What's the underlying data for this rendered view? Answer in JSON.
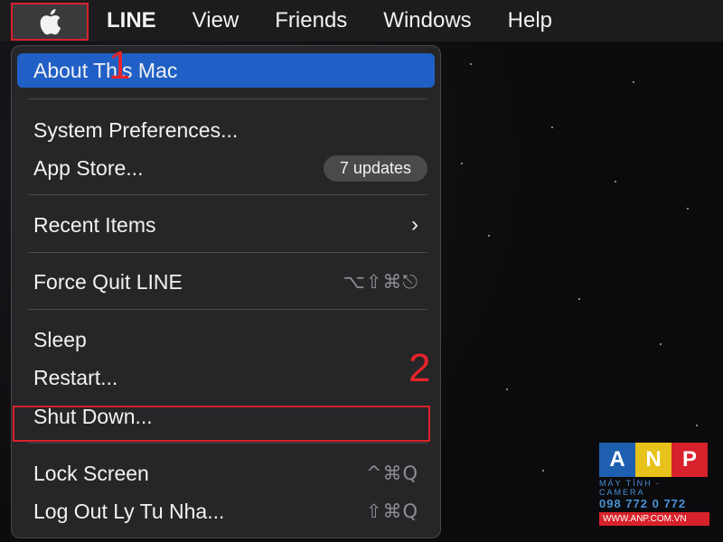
{
  "menubar": {
    "app_name": "LINE",
    "items": [
      "View",
      "Friends",
      "Windows",
      "Help"
    ]
  },
  "apple_menu": {
    "items": {
      "about": "About This Mac",
      "system_prefs": "System Preferences...",
      "app_store": "App Store...",
      "app_store_badge": "7 updates",
      "recent_items": "Recent Items",
      "force_quit": "Force Quit LINE",
      "force_quit_shortcut": "⌥⇧⌘⎋",
      "sleep": "Sleep",
      "restart": "Restart...",
      "shut_down": "Shut Down...",
      "lock_screen": "Lock Screen",
      "lock_screen_shortcut": "^⌘Q",
      "log_out": "Log Out Ly Tu Nha...",
      "log_out_shortcut": "⇧⌘Q"
    }
  },
  "annotations": {
    "step1": "1",
    "step2": "2"
  },
  "watermark": {
    "letters": [
      "A",
      "N",
      "P"
    ],
    "letter_colors": [
      "#1f5fb0",
      "#e7c21a",
      "#d8222b"
    ],
    "subtitle": "MÁY TÍNH - CAMERA",
    "phone": "098 772 0 772",
    "url": "WWW.ANP.COM.VN"
  },
  "colors": {
    "highlight": "#2060c6",
    "annotation": "#d8222b"
  }
}
